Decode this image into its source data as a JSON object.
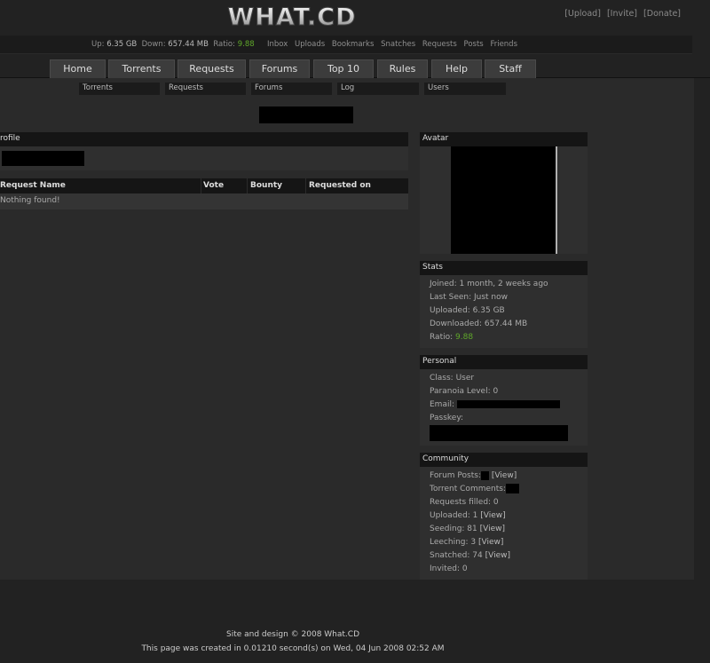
{
  "logo_text": "WHAT.CD",
  "top_links": [
    "[Upload]",
    "[Invite]",
    "[Donate]"
  ],
  "user_stats": {
    "up_label": "Up:",
    "up_value": "6.35 GB",
    "down_label": "Down:",
    "down_value": "657.44 MB",
    "ratio_label": "Ratio:",
    "ratio_value": "9.88"
  },
  "user_links": [
    "Inbox",
    "Uploads",
    "Bookmarks",
    "Snatches",
    "Requests",
    "Posts",
    "Friends"
  ],
  "menu_tabs": [
    "Home",
    "Torrents",
    "Requests",
    "Forums",
    "Top 10",
    "Rules",
    "Help",
    "Staff"
  ],
  "search_bars": [
    "Torrents",
    "Requests",
    "Forums",
    "Log",
    "Users"
  ],
  "profile": {
    "header": "rofile"
  },
  "requests_table": {
    "columns": [
      "Request Name",
      "Vote",
      "Bounty",
      "Requested on"
    ],
    "empty_text": "Nothing found!"
  },
  "avatar": {
    "header": "Avatar"
  },
  "stats": {
    "header": "Stats",
    "joined": "Joined: 1 month, 2 weeks ago",
    "last_seen": "Last Seen: Just now",
    "uploaded": "Uploaded: 6.35 GB",
    "downloaded": "Downloaded: 657.44 MB",
    "ratio_label": "Ratio:",
    "ratio_value": "9.88"
  },
  "personal": {
    "header": "Personal",
    "class": "Class: User",
    "paranoia": "Paranoia Level: 0",
    "email_label": "Email:",
    "passkey_label": "Passkey:"
  },
  "community": {
    "header": "Community",
    "forum_posts_label": "Forum Posts:",
    "view": "[View]",
    "torrent_comments_label": "Torrent Comments:",
    "requests_filled": "Requests filled: 0",
    "uploaded_label": "Uploaded: 1",
    "seeding_label": "Seeding: 81",
    "leeching_label": "Leeching: 3",
    "snatched_label": "Snatched: 74",
    "invited": "Invited: 0"
  },
  "footer": {
    "line1": "Site and design © 2008 What.CD",
    "line2": "This page was created in 0.01210 second(s) on Wed, 04 Jun 2008 02:52 AM"
  }
}
